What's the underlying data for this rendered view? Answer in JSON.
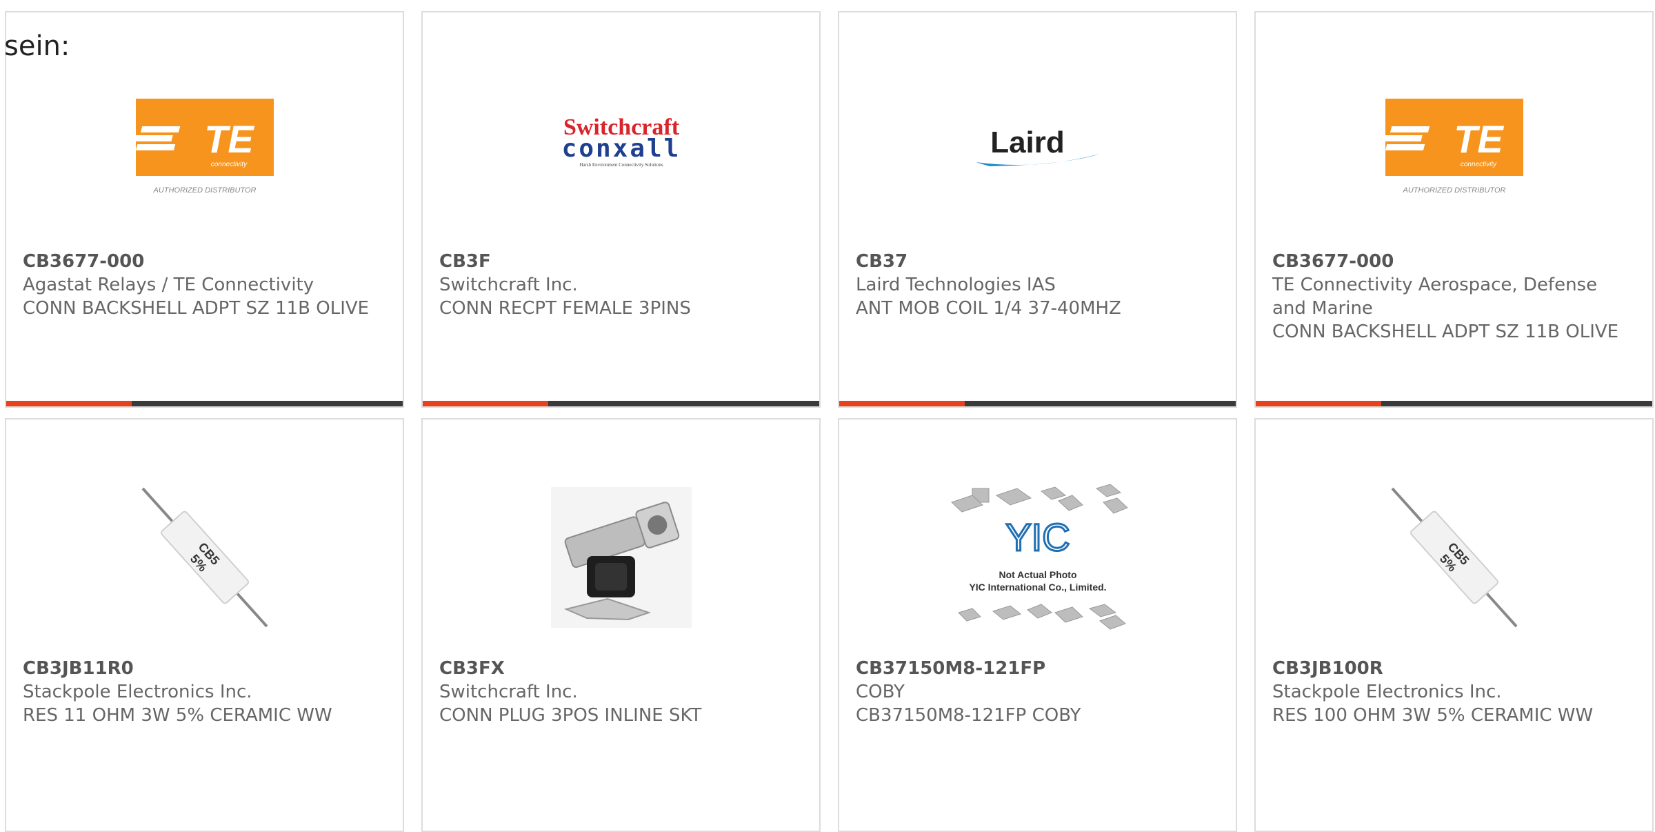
{
  "intro_text": "sein:",
  "colors": {
    "accent": "#e8421c",
    "bar": "#3a3a3a",
    "te_orange": "#f7941d"
  },
  "logos": {
    "te": {
      "text": "TE",
      "sub": "connectivity",
      "tagline": "AUTHORIZED DISTRIBUTOR"
    },
    "switchcraft": {
      "line1": "Switchcraft",
      "line2": "conxall",
      "tagline": "Harsh Environment Connectivity Solutions"
    },
    "laird": {
      "text": "Laird"
    },
    "yic": {
      "text": "YIC",
      "line1": "Not Actual Photo",
      "line2": "YIC International Co., Limited."
    }
  },
  "cards": [
    {
      "part": "CB3677-000",
      "maker": "Agastat Relays / TE Connectivity",
      "desc": "CONN BACKSHELL ADPT SZ 11B OLIVE",
      "image": "te-logo"
    },
    {
      "part": "CB3F",
      "maker": "Switchcraft Inc.",
      "desc": "CONN RECPT FEMALE 3PINS",
      "image": "switchcraft-logo"
    },
    {
      "part": "CB37",
      "maker": "Laird Technologies IAS",
      "desc": "ANT MOB COIL 1/4 37-40MHZ",
      "image": "laird-logo"
    },
    {
      "part": "CB3677-000",
      "maker": "TE Connectivity Aerospace, Defense and Marine",
      "desc": "CONN BACKSHELL ADPT SZ 11B OLIVE",
      "image": "te-logo"
    },
    {
      "part": "CB3JB11R0",
      "maker": "Stackpole Electronics Inc.",
      "desc": "RES 11 OHM 3W 5% CERAMIC WW",
      "image": "resistor-photo"
    },
    {
      "part": "CB3FX",
      "maker": "Switchcraft Inc.",
      "desc": "CONN PLUG 3POS INLINE SKT",
      "image": "connector-photo"
    },
    {
      "part": "CB37150M8-121FP",
      "maker": "COBY",
      "desc": "CB37150M8-121FP COBY",
      "image": "yic-placeholder"
    },
    {
      "part": "CB3JB100R",
      "maker": "Stackpole Electronics Inc.",
      "desc": "RES 100 OHM 3W 5% CERAMIC WW",
      "image": "resistor-photo"
    }
  ],
  "resistor_label": {
    "line1": "CB5",
    "line2": "5%"
  }
}
